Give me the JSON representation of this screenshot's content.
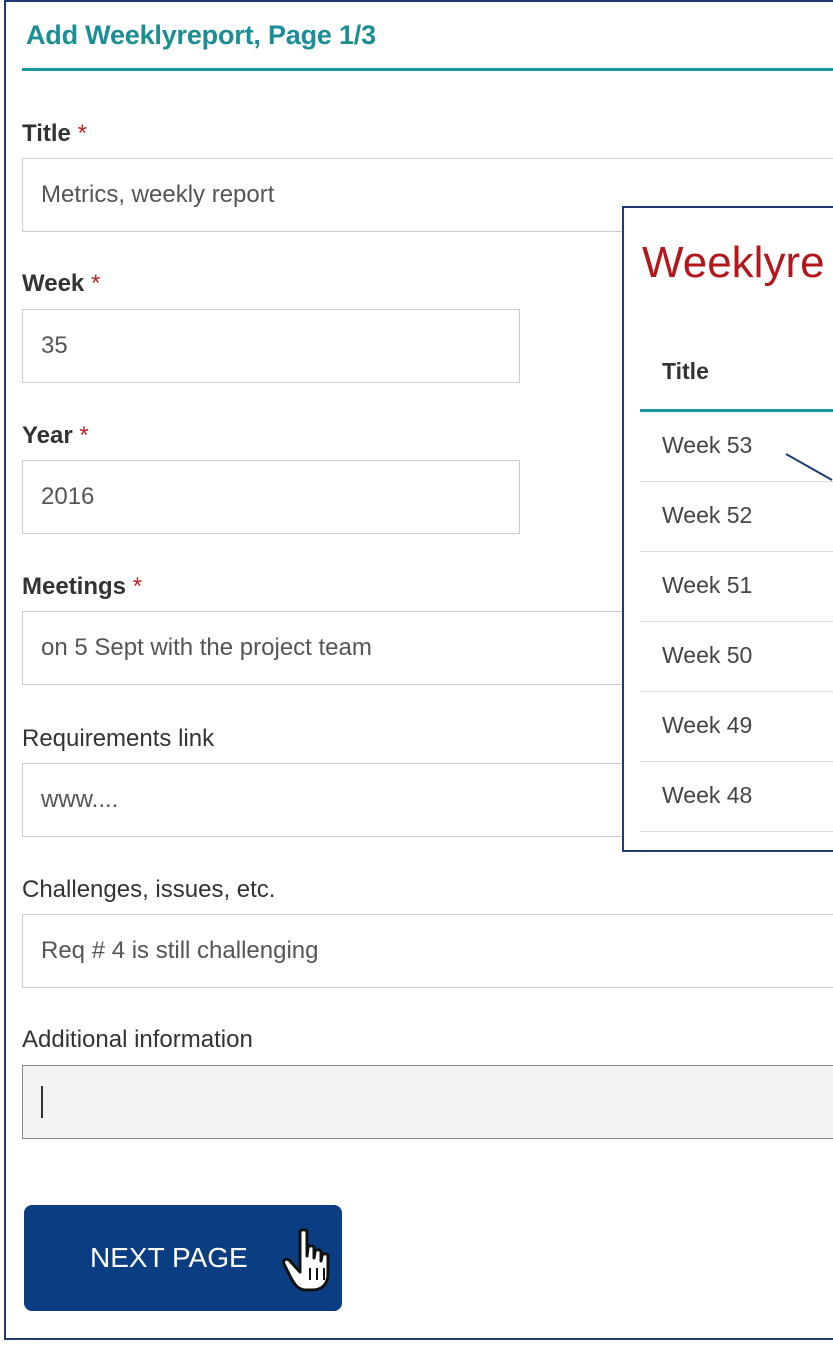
{
  "form": {
    "title": "Add Weeklyreport, Page 1/3",
    "required_marker": "*",
    "fields": {
      "title": {
        "label": "Title",
        "value": "Metrics, weekly report"
      },
      "week": {
        "label": "Week",
        "value": "35"
      },
      "year": {
        "label": "Year",
        "value": "2016"
      },
      "meetings": {
        "label": "Meetings",
        "value": "on 5 Sept with the project team"
      },
      "requirements_link": {
        "label": "Requirements link",
        "value": "www...."
      },
      "challenges": {
        "label": "Challenges, issues, etc.",
        "value": "Req # 4 is still challenging"
      },
      "additional_info": {
        "label": "Additional information",
        "value": ""
      }
    },
    "next_button": {
      "label": "NEXT PAGE",
      "icon": "hand-pointer-icon"
    }
  },
  "overlay": {
    "title": "Weeklyre",
    "column_header": "Title",
    "rows": [
      "Week 53",
      "Week 52",
      "Week 51",
      "Week 50",
      "Week 49",
      "Week 48"
    ]
  },
  "colors": {
    "accent_teal": "#1a8e94",
    "button_blue": "#0b3d82",
    "required_red": "#c02020",
    "overlay_title_red": "#b3161b",
    "frame_border": "#1f3b73"
  }
}
